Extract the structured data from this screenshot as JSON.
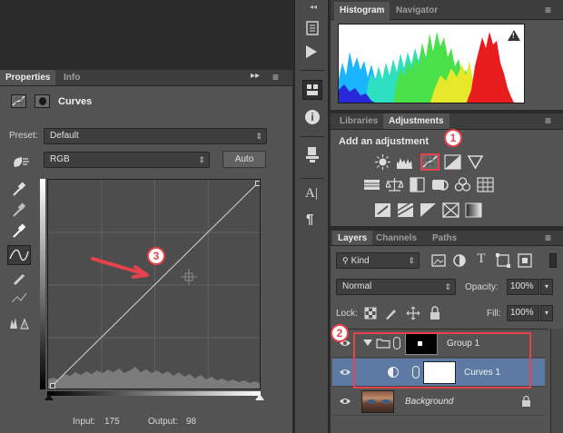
{
  "properties_panel": {
    "tabs": [
      "Properties",
      "Info"
    ],
    "title": "Curves",
    "preset_label": "Preset:",
    "preset_value": "Default",
    "channel_value": "RGB",
    "auto_label": "Auto",
    "input_label": "Input:",
    "input_value": "175",
    "output_label": "Output:",
    "output_value": "98"
  },
  "histogram_panel": {
    "tabs": [
      "Histogram",
      "Navigator"
    ],
    "warning_symbol": "!"
  },
  "adjustments_panel": {
    "tabs": [
      "Libraries",
      "Adjustments"
    ],
    "heading": "Add an adjustment"
  },
  "layers_panel": {
    "tabs": [
      "Layers",
      "Channels",
      "Paths"
    ],
    "filter_value": "Kind",
    "blend_mode": "Normal",
    "opacity_label": "Opacity:",
    "opacity_value": "100%",
    "lock_label": "Lock:",
    "fill_label": "Fill:",
    "fill_value": "100%",
    "layers": [
      {
        "name": "Group 1"
      },
      {
        "name": "Curves 1"
      },
      {
        "name": "Background"
      }
    ]
  },
  "callouts": [
    "1",
    "2",
    "3"
  ],
  "colors": {
    "panel": "#535353",
    "dark": "#2b2b2b",
    "selected": "#5c7aa3",
    "callout_red": "#e7414b"
  },
  "histogram": {
    "colors": [
      "#1ab4ff",
      "#2ee0c0",
      "#4ae04a",
      "#e8e82a",
      "#e81c1c",
      "#2828d8"
    ]
  }
}
